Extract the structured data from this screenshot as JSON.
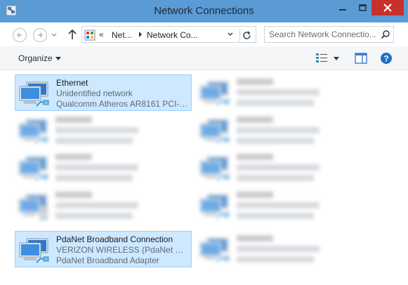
{
  "window": {
    "title": "Network Connections"
  },
  "address": {
    "overflow": "«",
    "crumbs": [
      "Net...",
      "Network Co..."
    ]
  },
  "search": {
    "placeholder": "Search Network Connectio..."
  },
  "toolbar": {
    "organize": "Organize"
  },
  "connections": [
    {
      "name": "Ethernet",
      "status": "Unidentified network",
      "device": "Qualcomm Atheros AR8161 PCI-E...",
      "selected": true,
      "icon": "ethernet-icon"
    },
    {
      "name": "",
      "status": "",
      "device": "",
      "selected": false,
      "icon": "ethernet-icon"
    },
    {
      "name": "",
      "status": "",
      "device": "",
      "selected": false,
      "icon": "ethernet-icon"
    },
    {
      "name": "",
      "status": "",
      "device": "",
      "selected": false,
      "icon": "vpn-icon"
    },
    {
      "name": "PdaNet Broadband Connection",
      "status": "VERIZON WIRELESS (PdaNet Broa...",
      "device": "PdaNet Broadband Adapter",
      "selected": true,
      "icon": "broadband-icon"
    },
    {
      "name": "",
      "status": "",
      "device": "",
      "selected": false,
      "icon": "ethernet-icon"
    },
    {
      "name": "",
      "status": "",
      "device": "",
      "selected": false,
      "icon": "ethernet-icon"
    },
    {
      "name": "",
      "status": "",
      "device": "",
      "selected": false,
      "icon": "ethernet-icon"
    },
    {
      "name": "",
      "status": "",
      "device": "",
      "selected": false,
      "icon": "ethernet-icon"
    },
    {
      "name": "",
      "status": "",
      "device": "",
      "selected": false,
      "icon": "wifi-icon"
    }
  ],
  "colors": {
    "titlebar": "#5b9bd5",
    "close": "#c7312c",
    "selection": "#cde8ff",
    "selection_border": "#99d1ff"
  }
}
